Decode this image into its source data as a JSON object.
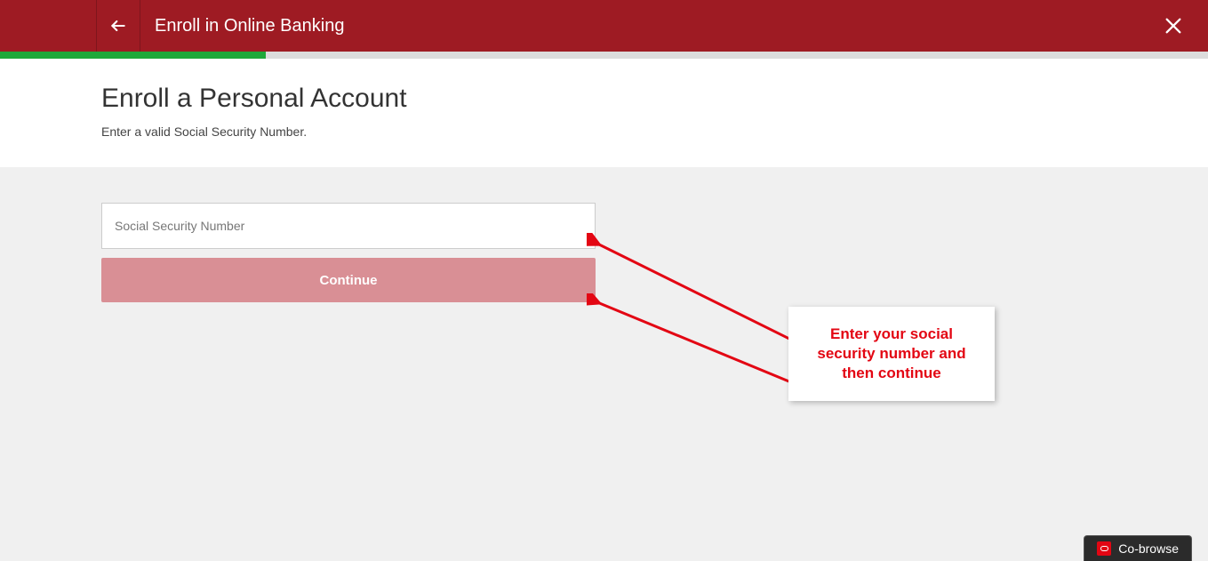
{
  "header": {
    "title": "Enroll in Online Banking"
  },
  "progress": {
    "percent": 22
  },
  "page": {
    "heading": "Enroll a Personal Account",
    "instruction": "Enter a valid Social Security Number."
  },
  "form": {
    "ssn_placeholder": "Social Security Number",
    "ssn_value": "",
    "continue_label": "Continue"
  },
  "callout": {
    "text": "Enter your social security number and then continue"
  },
  "footer": {
    "cobrowse_label": "Co-browse"
  },
  "icons": {
    "back": "back-arrow-icon",
    "close": "close-icon",
    "oracle": "oracle-icon"
  }
}
